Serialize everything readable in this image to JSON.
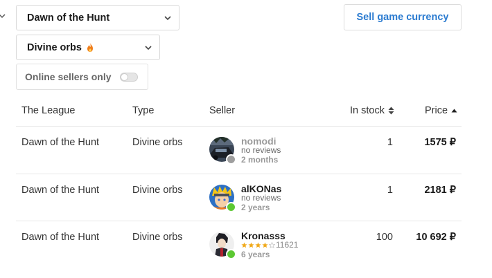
{
  "filters": {
    "league_select_value": "Dawn of the Hunt",
    "currency_select_value": "Divine orbs",
    "online_only_label": "Online sellers only",
    "online_only_enabled": false
  },
  "actions": {
    "sell_label": "Sell game currency"
  },
  "table": {
    "headers": {
      "league": "The League",
      "type": "Type",
      "seller": "Seller",
      "stock": "In stock",
      "price": "Price"
    },
    "rows": [
      {
        "league": "Dawn of the Hunt",
        "type": "Divine orbs",
        "seller_name": "nomodi",
        "seller_reviews": "no reviews",
        "seller_age": "2 months",
        "online": false,
        "stock": "1",
        "price": "1575 ₽"
      },
      {
        "league": "Dawn of the Hunt",
        "type": "Divine orbs",
        "seller_name": "alKONas",
        "seller_reviews": "no reviews",
        "seller_age": "2 years",
        "online": true,
        "stock": "1",
        "price": "2181 ₽"
      },
      {
        "league": "Dawn of the Hunt",
        "type": "Divine orbs",
        "seller_name": "Kronasss",
        "seller_rating_stars": 4,
        "seller_review_count": "11621",
        "seller_age": "6 years",
        "online": true,
        "stock": "100",
        "price": "10 692 ₽"
      }
    ]
  },
  "colors": {
    "accent_blue": "#2b7bd0",
    "online_green": "#5cc832",
    "offline_gray": "#9e9e9e",
    "star_gold": "#f0a91a",
    "fire_orange": "#f07d1a"
  }
}
